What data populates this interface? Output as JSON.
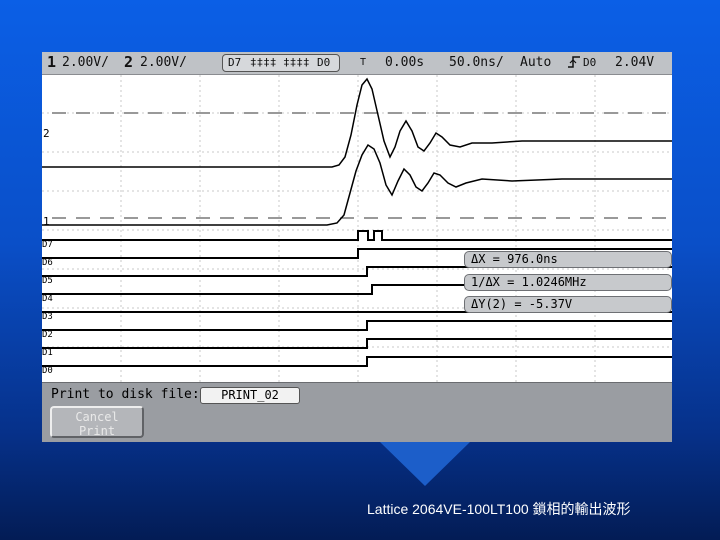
{
  "status": {
    "ch1_num": "1",
    "ch1_scale": "2.00V/",
    "ch2_num": "2",
    "ch2_scale": "2.00V/",
    "digital_range_start": "D7",
    "digital_glyphs": "‡‡‡‡ ‡‡‡‡",
    "digital_range_end": "D0",
    "trigger_marker": "T",
    "time_offset": "0.00s",
    "time_scale": "50.0ns/",
    "trigger_mode": "Auto",
    "trigger_edge_icon": "rising-edge-icon",
    "trigger_source": "D0",
    "trigger_level": "2.04V"
  },
  "markers": {
    "ch2": "2",
    "ch1": "1",
    "digital": [
      "D7",
      "D6",
      "D5",
      "D4",
      "D3",
      "D2",
      "D1",
      "D0"
    ]
  },
  "cursors": {
    "delta_x": "ΔX = 976.0ns",
    "inv_delta_x": "1/ΔX = 1.0246MHz",
    "delta_y": "ΔY(2) = -5.37V"
  },
  "bottom": {
    "print_label": "Print to disk file:",
    "print_file": "PRINT_02",
    "cancel_line1": "Cancel",
    "cancel_line2": "Print"
  },
  "caption": "Lattice 2064VE-100LT100 鎖相的輸出波形",
  "colors": {
    "background_top": "#0b5fe6",
    "background_bottom": "#031c55",
    "status_bar": "#bfc2c6",
    "trace": "#000000",
    "grid": "#c8c8c8"
  }
}
